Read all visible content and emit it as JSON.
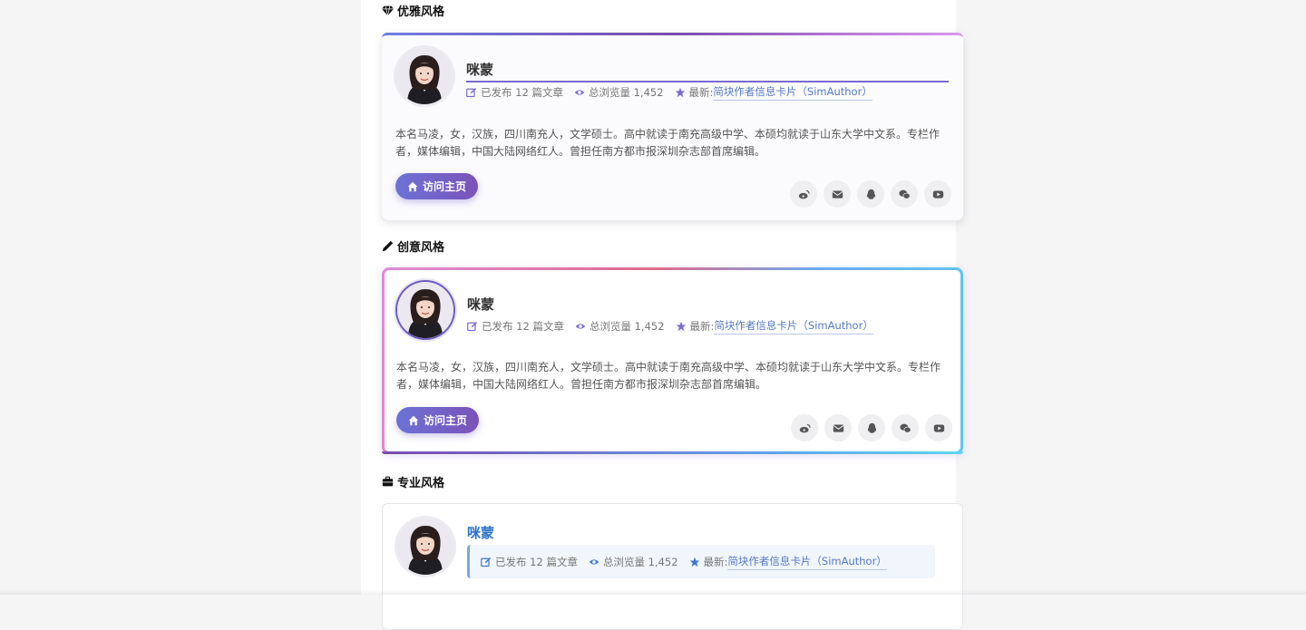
{
  "sections": [
    {
      "title": "优雅风格",
      "icon": "diamond-icon"
    },
    {
      "title": "创意风格",
      "icon": "pencil-icon"
    },
    {
      "title": "专业风格",
      "icon": "briefcase-icon"
    }
  ],
  "author": {
    "name": "咪蒙",
    "published_label": "已发布 12 篇文章",
    "views_label": "总浏览量 1,452",
    "latest_prefix": "最新:",
    "latest_title": "简块作者信息卡片（SimAuthor）",
    "bio": "本名马凌，女，汉族，四川南充人，文学硕士。高中就读于南充高级中学、本硕均就读于山东大学中文系。专栏作者，媒体编辑，中国大陆网络红人。曾担任南方都市报深圳杂志部首席编辑。"
  },
  "visit_button": {
    "label": "访问主页",
    "icon": "home-icon"
  },
  "socials": [
    "weibo-icon",
    "mail-icon",
    "qq-icon",
    "wechat-icon",
    "youtube-icon"
  ],
  "colors": {
    "accent_purple": "#7b52b8",
    "accent_blue": "#5679c4",
    "professional_name": "#2f73c9"
  }
}
